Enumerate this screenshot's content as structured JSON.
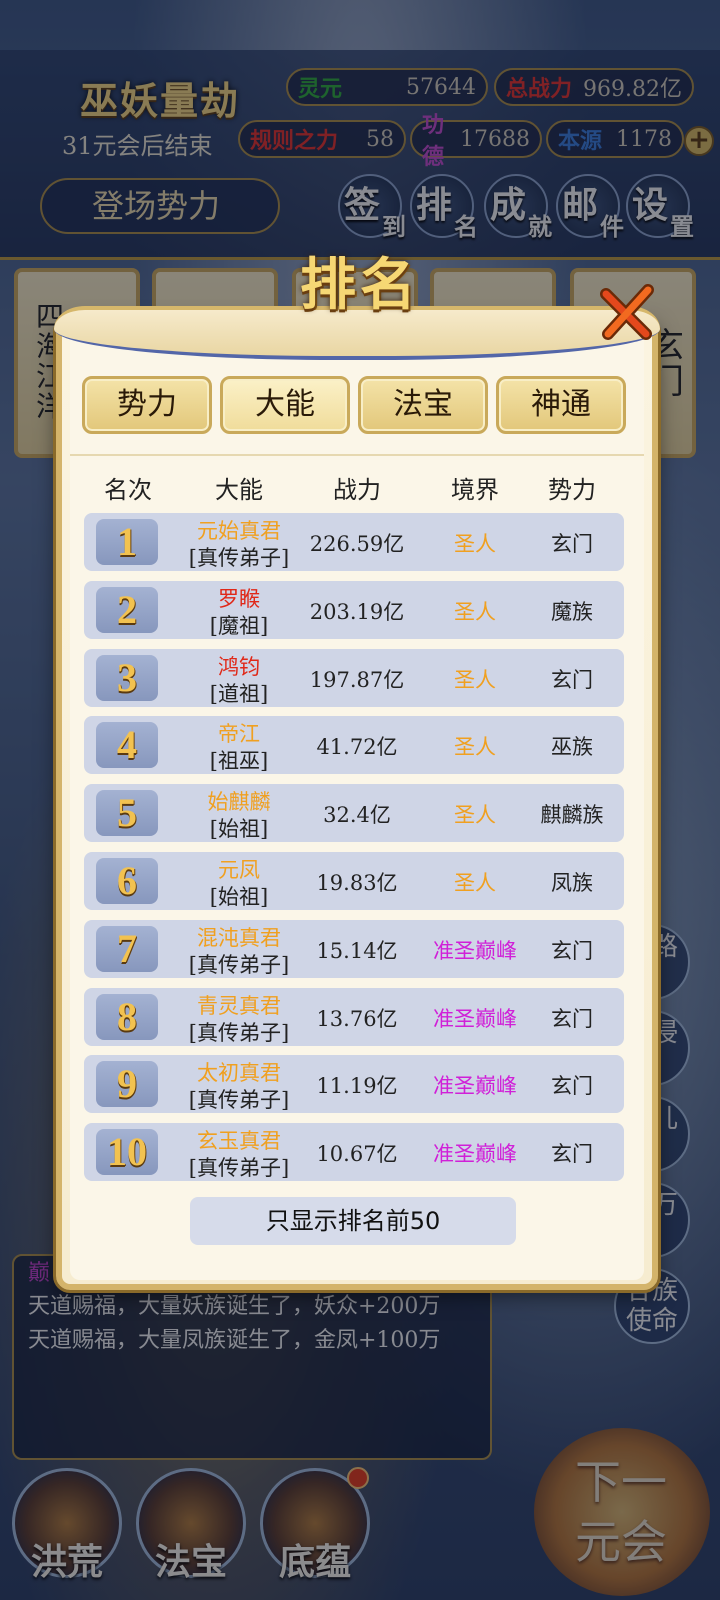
{
  "header": {
    "game_title": "巫妖量劫",
    "end_text": "31元会后结束",
    "stats": [
      {
        "key": "灵元",
        "value": "57644",
        "key_color": "#2fa83a"
      },
      {
        "key": "总战力",
        "value": "969.82亿",
        "key_color": "#e0302a"
      },
      {
        "key": "规则之力",
        "value": "58",
        "key_color": "#e0302a"
      },
      {
        "key": "功德",
        "value": "17688",
        "key_color": "#c04ac8"
      },
      {
        "key": "本源",
        "value": "1178",
        "key_color": "#3a7ad8"
      }
    ],
    "sub_button": "登场势力",
    "menu": [
      {
        "big": "签",
        "small": "到"
      },
      {
        "big": "排",
        "small": "名"
      },
      {
        "big": "成",
        "small": "就"
      },
      {
        "big": "邮",
        "small": "件"
      },
      {
        "big": "设",
        "small": "置"
      }
    ]
  },
  "background": {
    "scroll_left_text": "四海江洋",
    "scroll_right_text": "玄门",
    "side_buttons": [
      "道路",
      "域侵",
      "道儿",
      "身万",
      "各族使命"
    ]
  },
  "news": {
    "partial_top": "巅",
    "lines": [
      "天道赐福，大量妖族诞生了，妖众+200万",
      "天道赐福，大量凤族诞生了，金凤+100万"
    ]
  },
  "bottom_nav": [
    "洪荒",
    "法宝",
    "底蕴"
  ],
  "next_button": "下一元会",
  "modal": {
    "title": "排名",
    "tabs": [
      "势力",
      "大能",
      "法宝",
      "神通"
    ],
    "active_tab": 1,
    "columns": [
      "名次",
      "大能",
      "战力",
      "境界",
      "势力"
    ],
    "rows": [
      {
        "rank": "1",
        "name": "元始真君",
        "title": "[真传弟子]",
        "power": "226.59亿",
        "realm": "圣人",
        "faction": "玄门",
        "name_color": "orange",
        "realm_color": "orange"
      },
      {
        "rank": "2",
        "name": "罗睺",
        "title": "[魔祖]",
        "power": "203.19亿",
        "realm": "圣人",
        "faction": "魔族",
        "name_color": "red",
        "realm_color": "orange"
      },
      {
        "rank": "3",
        "name": "鸿钧",
        "title": "[道祖]",
        "power": "197.87亿",
        "realm": "圣人",
        "faction": "玄门",
        "name_color": "red",
        "realm_color": "orange"
      },
      {
        "rank": "4",
        "name": "帝江",
        "title": "[祖巫]",
        "power": "41.72亿",
        "realm": "圣人",
        "faction": "巫族",
        "name_color": "orange",
        "realm_color": "orange"
      },
      {
        "rank": "5",
        "name": "始麒麟",
        "title": "[始祖]",
        "power": "32.4亿",
        "realm": "圣人",
        "faction": "麒麟族",
        "name_color": "orange",
        "realm_color": "orange"
      },
      {
        "rank": "6",
        "name": "元凤",
        "title": "[始祖]",
        "power": "19.83亿",
        "realm": "圣人",
        "faction": "凤族",
        "name_color": "orange",
        "realm_color": "orange"
      },
      {
        "rank": "7",
        "name": "混沌真君",
        "title": "[真传弟子]",
        "power": "15.14亿",
        "realm": "准圣巅峰",
        "faction": "玄门",
        "name_color": "orange",
        "realm_color": "magenta"
      },
      {
        "rank": "8",
        "name": "青灵真君",
        "title": "[真传弟子]",
        "power": "13.76亿",
        "realm": "准圣巅峰",
        "faction": "玄门",
        "name_color": "orange",
        "realm_color": "magenta"
      },
      {
        "rank": "9",
        "name": "太初真君",
        "title": "[真传弟子]",
        "power": "11.19亿",
        "realm": "准圣巅峰",
        "faction": "玄门",
        "name_color": "orange",
        "realm_color": "magenta"
      },
      {
        "rank": "10",
        "name": "玄玉真君",
        "title": "[真传弟子]",
        "power": "10.67亿",
        "realm": "准圣巅峰",
        "faction": "玄门",
        "name_color": "orange",
        "realm_color": "magenta"
      }
    ],
    "footer_button": "只显示排名前50"
  }
}
